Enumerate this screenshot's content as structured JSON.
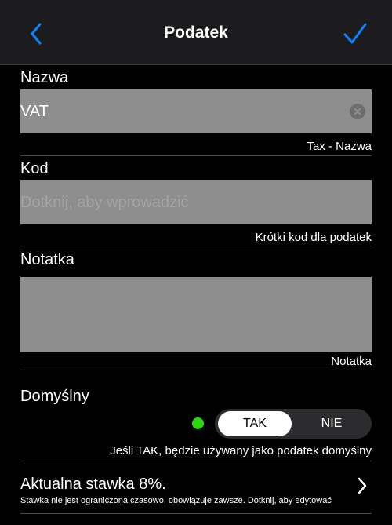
{
  "navbar": {
    "title": "Podatek"
  },
  "name_section": {
    "label": "Nazwa",
    "value": "VAT",
    "hint": "Tax - Nazwa"
  },
  "code_section": {
    "label": "Kod",
    "placeholder": "Dotknij, aby wprowadzić",
    "hint": "Krótki kod dla podatek"
  },
  "note_section": {
    "label": "Notatka",
    "value": "",
    "hint": "Notatka"
  },
  "default_section": {
    "label": "Domyślny",
    "options": [
      "TAK",
      "NIE"
    ],
    "selected": "TAK",
    "hint": "Jeśli TAK, będzie używany jako podatek domyślny"
  },
  "rate_section": {
    "title": "Aktualna stawka 8%.",
    "subtitle": "Stawka nie jest ograniczona czasowo, obowiązuje zawsze. Dotknij, aby edytować"
  },
  "colors": {
    "accent": "#0a84ff",
    "status_green": "#2bd80a",
    "field_bg": "#8e8e8e",
    "nav_bg": "#1c1c1e"
  }
}
